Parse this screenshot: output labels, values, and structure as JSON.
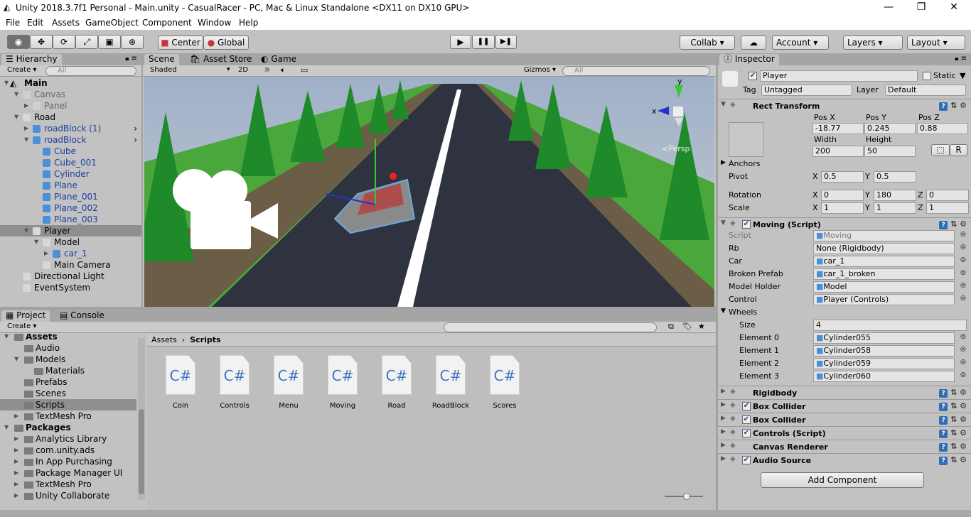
{
  "window": {
    "title": "Unity 2018.3.7f1 Personal - Main.unity - CasualRacer - PC, Mac & Linux Standalone <DX11 on DX10 GPU>",
    "minimize": "—",
    "maximize": "❐",
    "close": "✕"
  },
  "menu": [
    "File",
    "Edit",
    "Assets",
    "GameObject",
    "Component",
    "Window",
    "Help"
  ],
  "toolbar": {
    "tools": [
      "view-tool",
      "move-tool",
      "rotate-tool",
      "scale-tool",
      "rect-tool",
      "transform-tool"
    ],
    "pivot": "Center",
    "space": "Global",
    "collab": "Collab ▾",
    "account": "Account",
    "layers": "Layers",
    "layout": "Layout"
  },
  "hierarchy": {
    "tab": "Hierarchy",
    "create": "Create ▾",
    "search_placeholder": "All",
    "items": [
      {
        "label": "Main",
        "depth": 0,
        "arrow": "▼",
        "bold": true,
        "type": "scene"
      },
      {
        "label": "Canvas",
        "depth": 1,
        "arrow": "▼",
        "type": "go",
        "dim": true
      },
      {
        "label": "Panel",
        "depth": 2,
        "arrow": "▶",
        "type": "go",
        "dim": true
      },
      {
        "label": "Road",
        "depth": 1,
        "arrow": "▼",
        "type": "go"
      },
      {
        "label": "roadBlock (1)",
        "depth": 2,
        "arrow": "▶",
        "type": "prefab",
        "more": true
      },
      {
        "label": "roadBlock",
        "depth": 2,
        "arrow": "▼",
        "type": "prefab",
        "more": true
      },
      {
        "label": "Cube",
        "depth": 3,
        "type": "prefab-child"
      },
      {
        "label": "Cube_001",
        "depth": 3,
        "type": "prefab-child"
      },
      {
        "label": "Cylinder",
        "depth": 3,
        "type": "prefab-child"
      },
      {
        "label": "Plane",
        "depth": 3,
        "type": "prefab-child"
      },
      {
        "label": "Plane_001",
        "depth": 3,
        "type": "prefab-child"
      },
      {
        "label": "Plane_002",
        "depth": 3,
        "type": "prefab-child"
      },
      {
        "label": "Plane_003",
        "depth": 3,
        "type": "prefab-child"
      },
      {
        "label": "Player",
        "depth": 2,
        "arrow": "▼",
        "type": "go",
        "selected": true
      },
      {
        "label": "Model",
        "depth": 3,
        "arrow": "▼",
        "type": "go"
      },
      {
        "label": "car_1",
        "depth": 4,
        "arrow": "▶",
        "type": "prefab"
      },
      {
        "label": "Main Camera",
        "depth": 3,
        "type": "go"
      },
      {
        "label": "Directional Light",
        "depth": 1,
        "type": "go"
      },
      {
        "label": "EventSystem",
        "depth": 1,
        "type": "go"
      }
    ]
  },
  "scene": {
    "tabs": [
      "Scene",
      "Asset Store",
      "Game"
    ],
    "shading": "Shaded",
    "mode2d": "2D",
    "gizmos": "Gizmos ▾",
    "search_placeholder": "All",
    "persp": "<Persp",
    "axis_y": "y",
    "axis_x": "x"
  },
  "play": {
    "play": "▶",
    "pause": "❚❚",
    "step": "▶❚"
  },
  "inspector": {
    "tab": "Inspector",
    "name": "Player",
    "active": true,
    "static": "Static",
    "tag_label": "Tag",
    "tag": "Untagged",
    "layer_label": "Layer",
    "layer": "Default",
    "rect_transform": {
      "title": "Rect Transform",
      "pos_x_label": "Pos X",
      "pos_y_label": "Pos Y",
      "pos_z_label": "Pos Z",
      "pos_x": "-18.77",
      "pos_y": "0.245",
      "pos_z": "0.88",
      "width_label": "Width",
      "height_label": "Height",
      "width": "200",
      "height": "50",
      "anchors": "Anchors",
      "pivot_label": "Pivot",
      "pivot_x": "0.5",
      "pivot_y": "0.5",
      "rotation_label": "Rotation",
      "rot_x": "0",
      "rot_y": "180",
      "rot_z": "0",
      "scale_label": "Scale",
      "scale_x": "1",
      "scale_y": "1",
      "scale_z": "1",
      "raw_button": "R",
      "x": "X",
      "y": "Y",
      "z": "Z"
    },
    "moving": {
      "title": "Moving (Script)",
      "fields": [
        {
          "label": "Script",
          "value": "Moving",
          "dim": true
        },
        {
          "label": "Rb",
          "value": "None (Rigidbody)"
        },
        {
          "label": "Car",
          "value": "car_1",
          "icon": true
        },
        {
          "label": "Broken Prefab",
          "value": "car_1_broken",
          "icon": true
        },
        {
          "label": "Model Holder",
          "value": "Model",
          "icon": true
        },
        {
          "label": "Control",
          "value": "Player (Controls)",
          "icon": true
        }
      ],
      "wheels_label": "Wheels",
      "size_label": "Size",
      "size": "4",
      "elements": [
        {
          "label": "Element 0",
          "value": "Cylinder055"
        },
        {
          "label": "Element 1",
          "value": "Cylinder058"
        },
        {
          "label": "Element 2",
          "value": "Cylinder059"
        },
        {
          "label": "Element 3",
          "value": "Cylinder060"
        }
      ]
    },
    "components": [
      {
        "title": "Rigidbody",
        "checkbox": false
      },
      {
        "title": "Box Collider",
        "checkbox": true
      },
      {
        "title": "Box Collider",
        "checkbox": true
      },
      {
        "title": "Controls (Script)",
        "checkbox": true
      },
      {
        "title": "Canvas Renderer",
        "checkbox": false
      },
      {
        "title": "Audio Source",
        "checkbox": true
      }
    ],
    "add_component": "Add Component"
  },
  "project": {
    "tabs": [
      "Project",
      "Console"
    ],
    "create": "Create ▾",
    "breadcrumb": [
      "Assets",
      "Scripts"
    ],
    "tree": [
      {
        "label": "Assets",
        "depth": 0,
        "arrow": "▼",
        "bold": true
      },
      {
        "label": "Audio",
        "depth": 1
      },
      {
        "label": "Models",
        "depth": 1,
        "arrow": "▼"
      },
      {
        "label": "Materials",
        "depth": 2
      },
      {
        "label": "Prefabs",
        "depth": 1
      },
      {
        "label": "Scenes",
        "depth": 1
      },
      {
        "label": "Scripts",
        "depth": 1,
        "selected": true
      },
      {
        "label": "TextMesh Pro",
        "depth": 1,
        "arrow": "▶"
      },
      {
        "label": "Packages",
        "depth": 0,
        "arrow": "▼",
        "bold": true
      },
      {
        "label": "Analytics Library",
        "depth": 1,
        "arrow": "▶"
      },
      {
        "label": "com.unity.ads",
        "depth": 1,
        "arrow": "▶"
      },
      {
        "label": "In App Purchasing",
        "depth": 1,
        "arrow": "▶"
      },
      {
        "label": "Package Manager UI",
        "depth": 1,
        "arrow": "▶"
      },
      {
        "label": "TextMesh Pro",
        "depth": 1,
        "arrow": "▶"
      },
      {
        "label": "Unity Collaborate",
        "depth": 1,
        "arrow": "▶"
      }
    ],
    "files": [
      "Coin",
      "Controls",
      "Menu",
      "Moving",
      "Road",
      "RoadBlock",
      "Scores"
    ],
    "file_glyph": "C#"
  }
}
